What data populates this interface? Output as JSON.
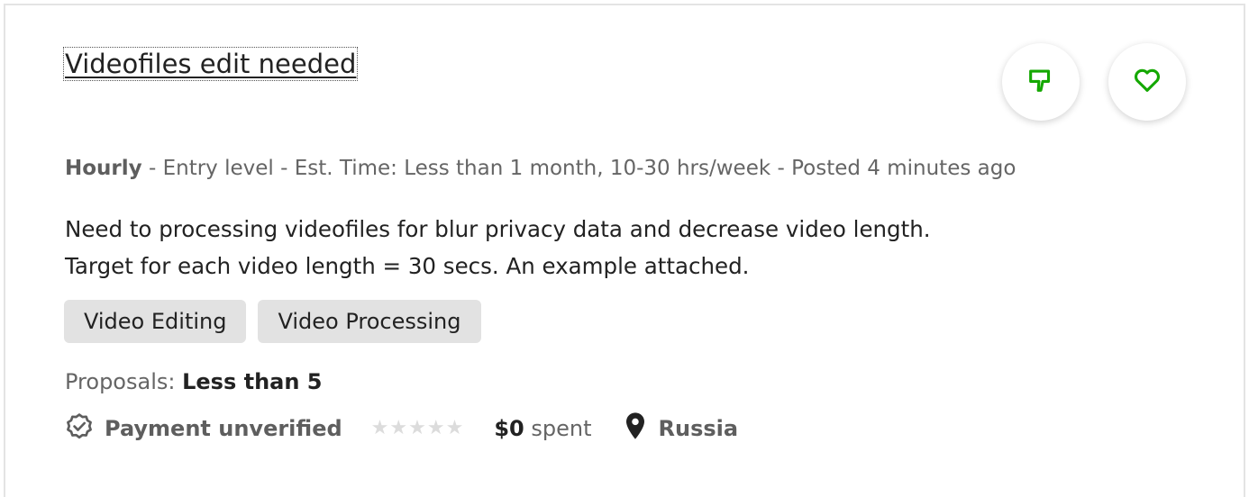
{
  "job": {
    "title": "Videofiles edit needed",
    "meta": {
      "job_type": "Hourly",
      "separator_1": " - ",
      "level": "Entry level",
      "separator_2": " - ",
      "estimate": "Est. Time: Less than 1 month, 10-30 hrs/week",
      "separator_3": " - ",
      "posted": "Posted 4 minutes ago"
    },
    "description_line_1": "Need to processing videofiles for blur privacy data and decrease video length.",
    "description_line_2": "Target for each video length = 30 secs. An example attached.",
    "skills": [
      {
        "label": "Video Editing"
      },
      {
        "label": "Video Processing"
      }
    ],
    "proposals": {
      "label": "Proposals:",
      "value": "Less than 5"
    },
    "client": {
      "payment_status": "Payment unverified",
      "rating_stars": 0,
      "rating_max": 5,
      "spent_amount": "$0",
      "spent_label": "spent",
      "location": "Russia"
    }
  },
  "icons": {
    "dislike": "thumbs-down-icon",
    "save": "heart-icon",
    "payment": "verified-badge-icon",
    "location": "map-pin-icon",
    "star": "star-icon"
  },
  "colors": {
    "accent": "#14a800",
    "text": "#222222",
    "muted": "#656565",
    "tag_bg": "#e2e2e2",
    "star_empty": "#dcdcdc"
  }
}
